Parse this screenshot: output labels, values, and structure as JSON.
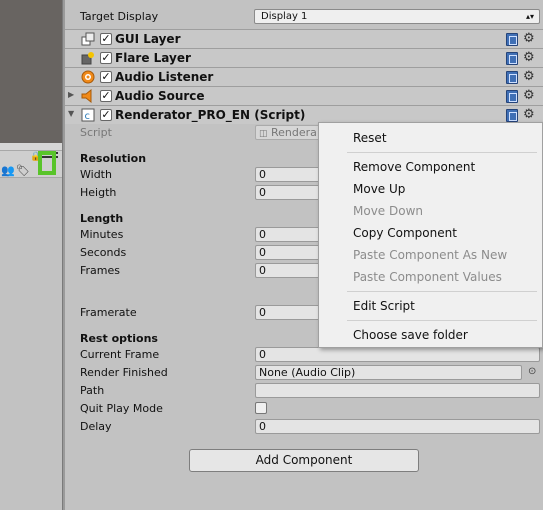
{
  "target_display": {
    "label": "Target Display",
    "value": "Display 1"
  },
  "components": [
    {
      "title": "GUI Layer"
    },
    {
      "title": "Flare Layer"
    },
    {
      "title": "Audio Listener"
    },
    {
      "title": "Audio Source"
    },
    {
      "title": "Renderator_PRO_EN (Script)"
    }
  ],
  "script_row": {
    "label": "Script",
    "value": "Rendera"
  },
  "resolution": {
    "header": "Resolution",
    "width_label": "Width",
    "width_value": "0",
    "height_label": "Heigth",
    "height_value": "0"
  },
  "length": {
    "header": "Length",
    "minutes_label": "Minutes",
    "minutes_value": "0",
    "seconds_label": "Seconds",
    "seconds_value": "0",
    "frames_label": "Frames",
    "frames_value": "0"
  },
  "framerate": {
    "label": "Framerate",
    "value": "0"
  },
  "rest_options": {
    "header": "Rest options",
    "current_frame_label": "Current Frame",
    "current_frame_value": "0",
    "render_finished_label": "Render Finished",
    "render_finished_value": "None (Audio Clip)",
    "path_label": "Path",
    "path_value": "",
    "quit_play_mode_label": "Quit Play Mode",
    "delay_label": "Delay",
    "delay_value": "0"
  },
  "add_component_label": "Add Component",
  "context_menu": {
    "reset": "Reset",
    "remove_component": "Remove Component",
    "move_up": "Move Up",
    "move_down": "Move Down",
    "copy_component": "Copy Component",
    "paste_as_new": "Paste Component As New",
    "paste_values": "Paste Component Values",
    "edit_script": "Edit Script",
    "choose_save_folder": "Choose save folder"
  },
  "colors": {
    "highlight": "#59c42a",
    "panel_bg": "#c2c2c2",
    "menu_bg": "#f0f0f0"
  }
}
